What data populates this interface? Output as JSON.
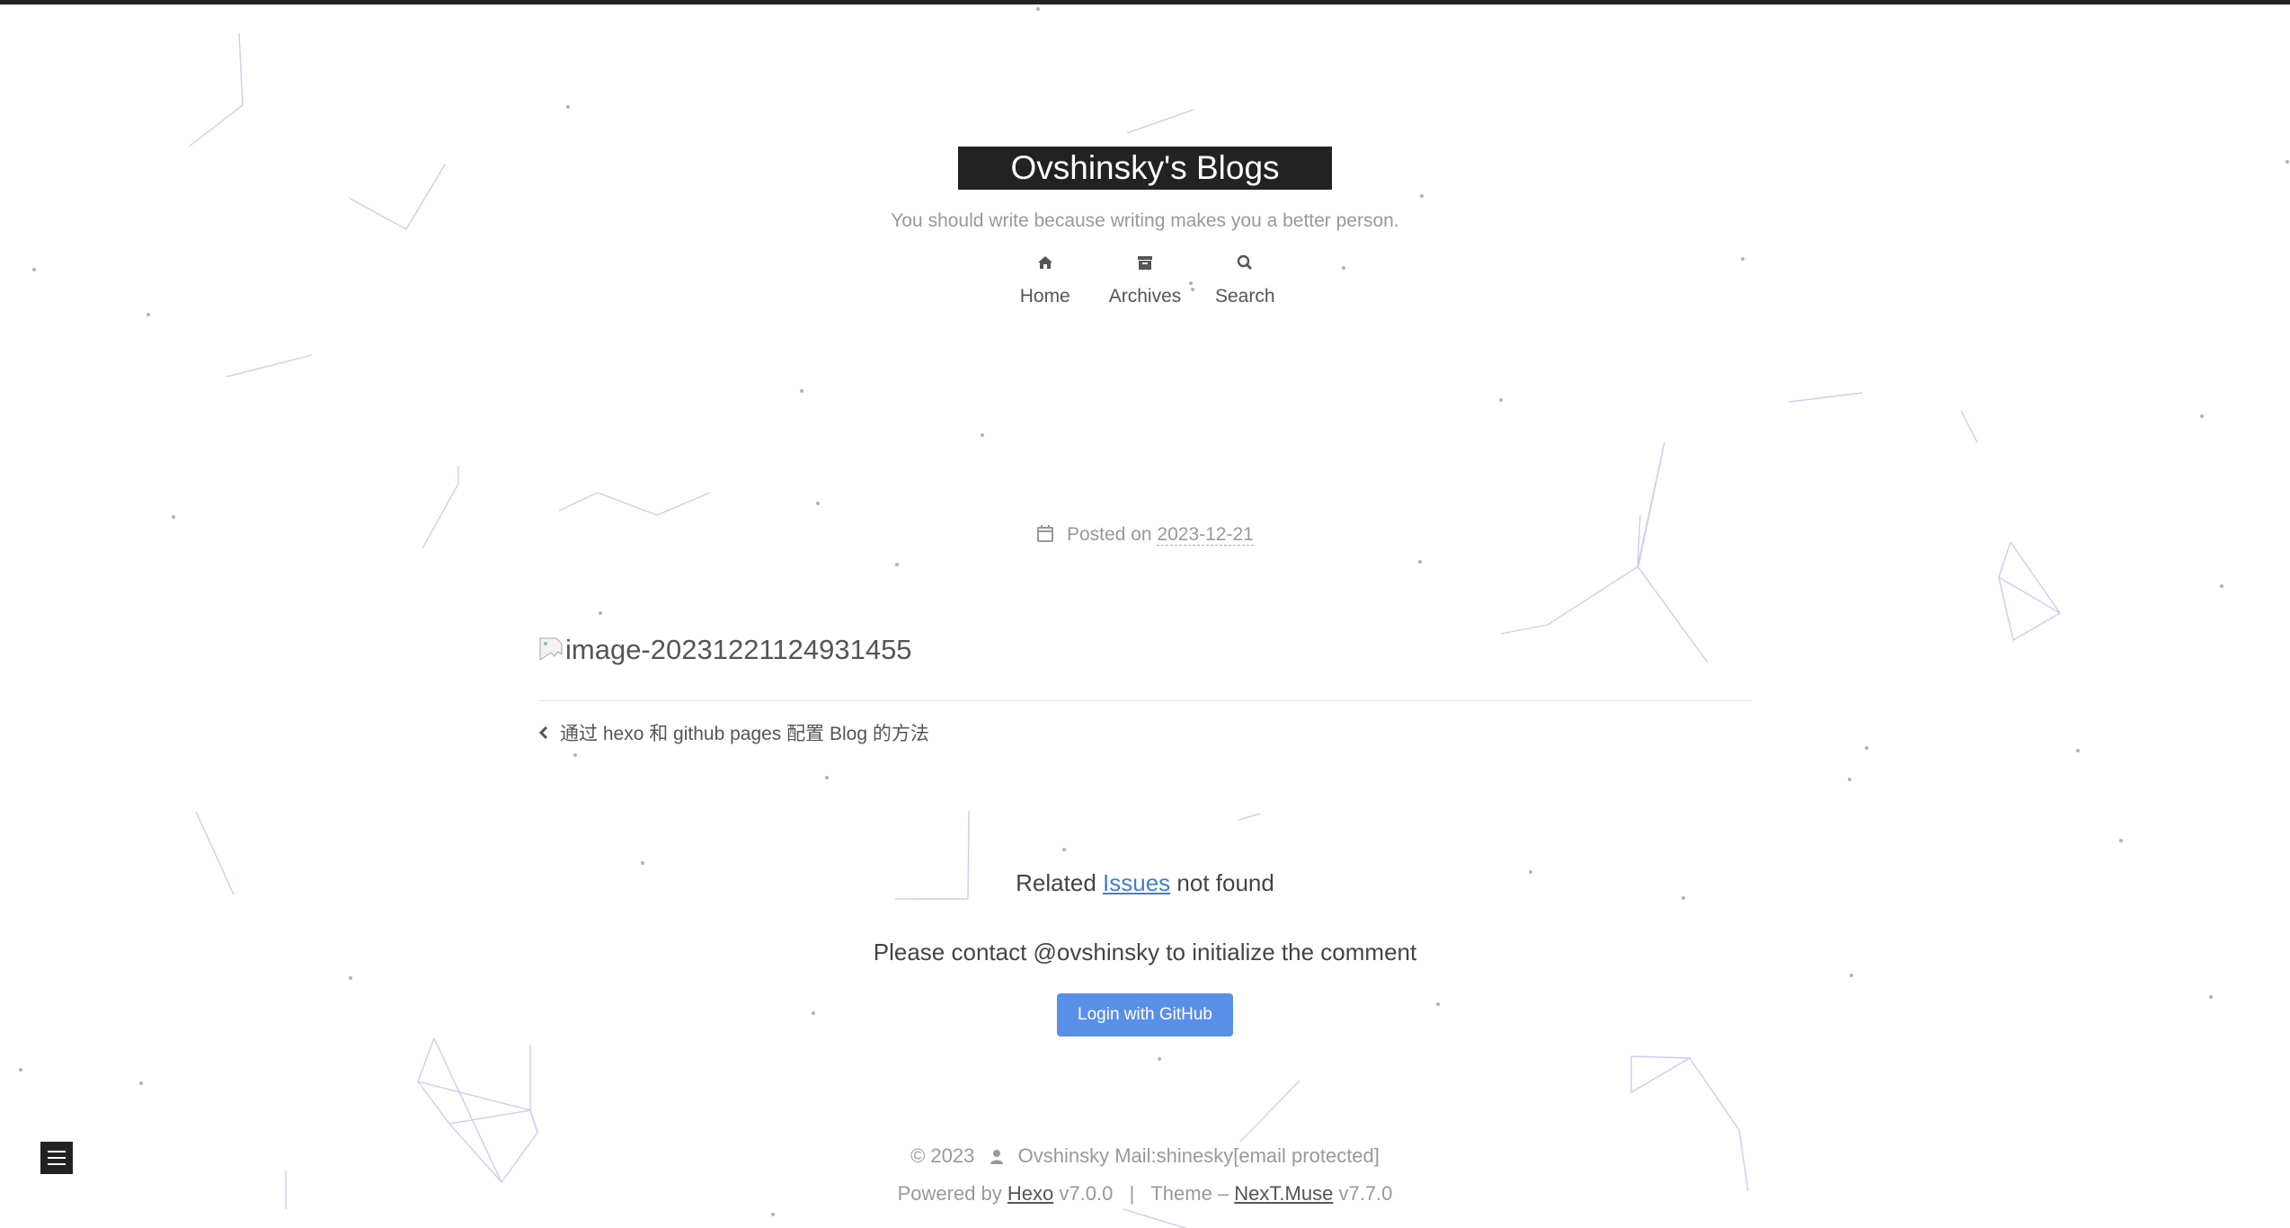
{
  "site": {
    "title": "Ovshinsky's Blogs",
    "subtitle": "You should write because writing makes you a better person."
  },
  "menu": [
    {
      "label": "Home",
      "icon": "home-icon"
    },
    {
      "label": "Archives",
      "icon": "archive-icon"
    },
    {
      "label": "Search",
      "icon": "search-icon"
    }
  ],
  "post": {
    "posted_on_label": "Posted on",
    "date": "2023-12-21",
    "image_alt": "image-20231221124931455",
    "prev_post_title": "通过 hexo 和 github pages 配置 Blog 的方法"
  },
  "comments": {
    "related_prefix": "Related",
    "issues_link": "Issues",
    "related_suffix": "not found",
    "contact_text": "Please contact @ovshinsky to initialize the comment",
    "login_button": "Login with GitHub"
  },
  "footer": {
    "copyright": "© 2023",
    "author": "Ovshinsky Mail:shinesky[email protected]",
    "powered_by": "Powered by",
    "hexo_link": "Hexo",
    "hexo_version": "v7.0.0",
    "separator": "|",
    "theme_label": "Theme –",
    "theme_link": "NexT.Muse",
    "theme_version": "v7.7.0"
  },
  "colors": {
    "brand_bg": "#222222",
    "link": "#3f7fd7",
    "button": "#5a8fe8",
    "particles": "#b4b4f0"
  }
}
